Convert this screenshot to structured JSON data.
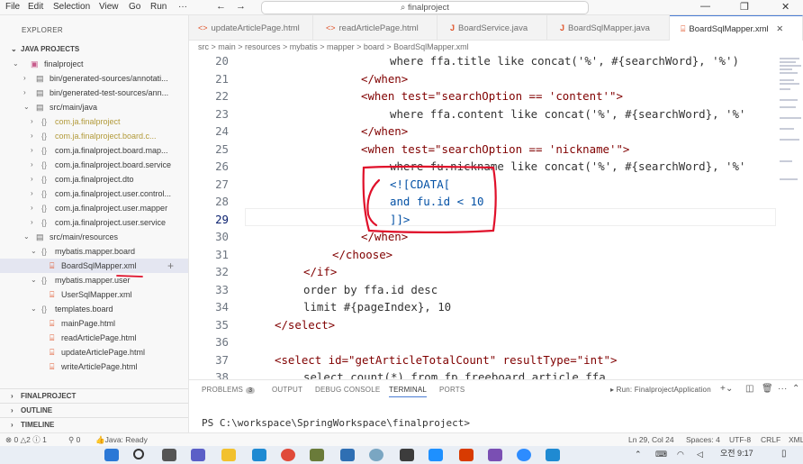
{
  "menu": {
    "items": [
      "File",
      "Edit",
      "Selection",
      "View",
      "Go",
      "Run",
      "···"
    ]
  },
  "search": {
    "text": "finalproject"
  },
  "explorer": {
    "title": "EXPLORER",
    "section_projects": "JAVA PROJECTS",
    "rows": [
      {
        "label": "finalproject",
        "icon": "project-icon"
      },
      {
        "label": "bin/generated-sources/annotati...",
        "icon": "folder-icon"
      },
      {
        "label": "bin/generated-test-sources/ann...",
        "icon": "folder-icon"
      },
      {
        "label": "src/main/java",
        "icon": "folder-icon"
      },
      {
        "label": "com.ja.finalproject",
        "icon": "package-icon"
      },
      {
        "label": "com.ja.finalproject.board.c...",
        "icon": "package-icon"
      },
      {
        "label": "com.ja.finalproject.board.map...",
        "icon": "package-icon"
      },
      {
        "label": "com.ja.finalproject.board.service",
        "icon": "package-icon"
      },
      {
        "label": "com.ja.finalproject.dto",
        "icon": "package-icon"
      },
      {
        "label": "com.ja.finalproject.user.control...",
        "icon": "package-icon"
      },
      {
        "label": "com.ja.finalproject.user.mapper",
        "icon": "package-icon"
      },
      {
        "label": "com.ja.finalproject.user.service",
        "icon": "package-icon"
      },
      {
        "label": "src/main/resources",
        "icon": "folder-icon"
      },
      {
        "label": "mybatis.mapper.board",
        "icon": "package-icon"
      },
      {
        "label": "BoardSqlMapper.xml",
        "icon": "xml-icon"
      },
      {
        "label": "mybatis.mapper.user",
        "icon": "package-icon"
      },
      {
        "label": "UserSqlMapper.xml",
        "icon": "xml-icon"
      },
      {
        "label": "templates.board",
        "icon": "package-icon"
      },
      {
        "label": "mainPage.html",
        "icon": "html-icon"
      },
      {
        "label": "readArticlePage.html",
        "icon": "html-icon"
      },
      {
        "label": "updateArticlePage.html",
        "icon": "html-icon"
      },
      {
        "label": "writeArticlePage.html",
        "icon": "html-icon"
      }
    ],
    "section_finalproject": "FINALPROJECT",
    "section_outline": "OUTLINE",
    "section_timeline": "TIMELINE"
  },
  "tabs": [
    {
      "label": "updateArticlePage.html"
    },
    {
      "label": "readArticlePage.html"
    },
    {
      "label": "BoardService.java"
    },
    {
      "label": "BoardSqlMapper.java"
    },
    {
      "label": "BoardSqlMapper.xml"
    }
  ],
  "breadcrumb": "src > main > resources > mybatis > mapper > board > BoardSqlMapper.xml",
  "editor": {
    "lines": [
      {
        "n": "20",
        "code": "where ffa.title like concat('%', #{searchWord}, '%')"
      },
      {
        "n": "21",
        "code": "</when>"
      },
      {
        "n": "22",
        "code": "<when test=\"searchOption == 'content'\">"
      },
      {
        "n": "23",
        "code": "where ffa.content like concat('%', #{searchWord}, '%'"
      },
      {
        "n": "24",
        "code": "</when>"
      },
      {
        "n": "25",
        "code": "<when test=\"searchOption == 'nickname'\">"
      },
      {
        "n": "26",
        "code": "where fu.nickname like concat('%', #{searchWord}, '%'"
      },
      {
        "n": "27",
        "code": "<![CDATA["
      },
      {
        "n": "28",
        "code": "and fu.id < 10"
      },
      {
        "n": "29",
        "code": "]]>"
      },
      {
        "n": "30",
        "code": "</when>"
      },
      {
        "n": "31",
        "code": "</choose>"
      },
      {
        "n": "32",
        "code": "</if>"
      },
      {
        "n": "33",
        "code": "order by ffa.id desc"
      },
      {
        "n": "34",
        "code": "limit #{pageIndex}, 10"
      },
      {
        "n": "35",
        "code": "</select>"
      },
      {
        "n": "36",
        "code": ""
      },
      {
        "n": "37",
        "code": "<select id=\"getArticleTotalCount\" resultType=\"int\">"
      },
      {
        "n": "38",
        "code": "select count(*) from fp_freeboard_article ffa"
      }
    ]
  },
  "panel": {
    "tabs": [
      "PROBLEMS",
      "OUTPUT",
      "DEBUG CONSOLE",
      "TERMINAL",
      "PORTS"
    ],
    "problems_count": "3",
    "run_label": "Run: FinalprojectApplication",
    "terminal": "PS C:\\workspace\\SpringWorkspace\\finalproject>"
  },
  "status": {
    "errors": "0",
    "warnings": "2",
    "info": "1",
    "ports": "0",
    "java": "Java: Ready",
    "position": "Ln 29, Col 24",
    "spaces": "Spaces: 4",
    "encoding": "UTF-8",
    "eol": "CRLF",
    "lang": "XML"
  },
  "taskbar": {
    "time": "오전 9:17"
  },
  "colors": {
    "annotation": "#e0102a",
    "accent": "#4a7dd4"
  }
}
